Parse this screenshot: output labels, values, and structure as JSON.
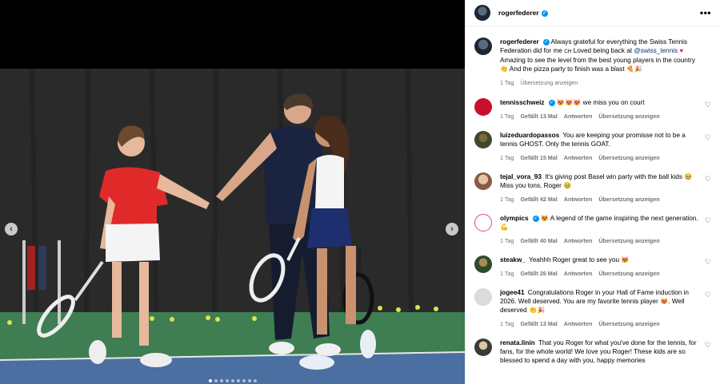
{
  "post": {
    "author": "rogerfederer",
    "more_label": "•••"
  },
  "caption": {
    "username": "rogerfederer",
    "text_1": "Always grateful for everything the Swiss Tennis Federation did for me ",
    "flag": "CH",
    "text_2": " Loved being back at ",
    "mention": "@swiss_tennis",
    "text_3": " Amazing to see the level from the best young players in the country ",
    "text_4": " And the pizza party to finish was a blast ",
    "time": "1 Tag",
    "translate": "Übersetzung anzeigen"
  },
  "comments": [
    {
      "username": "tennisschweiz",
      "verified": true,
      "text": "😻😻😻 we miss you on court",
      "time": "1 Tag",
      "likes": "Gefällt 13 Mal",
      "reply": "Antworten",
      "translate": "Übersetzung anzeigen"
    },
    {
      "username": "luizeduardopassos",
      "verified": false,
      "text": "You are keeping your promisse not to be a tennis GHOST. Only the tennis GOAT.",
      "time": "1 Tag",
      "likes": "Gefällt 15 Mal",
      "reply": "Antworten",
      "translate": "Übersetzung anzeigen"
    },
    {
      "username": "tejal_vora_93",
      "verified": false,
      "text": "It's giving post Basel win party with the ball kids 🥹 Miss you tons, Roger 🥹",
      "time": "1 Tag",
      "likes": "Gefällt 42 Mal",
      "reply": "Antworten",
      "translate": "Übersetzung anzeigen"
    },
    {
      "username": "olympics",
      "verified": true,
      "text": "😻 A legend of the game inspiring the next generation. 💪",
      "time": "1 Tag",
      "likes": "Gefällt 40 Mal",
      "reply": "Antworten",
      "translate": "Übersetzung anzeigen"
    },
    {
      "username": "steakw_",
      "verified": false,
      "text": "Yeahhh Roger great to see you 😻",
      "time": "1 Tag",
      "likes": "Gefällt 26 Mal",
      "reply": "Antworten",
      "translate": "Übersetzung anzeigen"
    },
    {
      "username": "jogee41",
      "verified": false,
      "text": "Congratulations Roger in your Hall of Fame induction in 2026. Well deserved. You are my favorite tennis player 😻. Well deserved 👏🎉",
      "time": "1 Tag",
      "likes": "Gefällt 13 Mal",
      "reply": "Antworten",
      "translate": "Übersetzung anzeigen"
    },
    {
      "username": "renata.linin",
      "verified": false,
      "text": "That you Roger for what you've done for the tennis, for fans, for the whole world! We love you Roger! These kids are so blessed to spend a day with you, happy memories",
      "time": "",
      "likes": "",
      "reply": "",
      "translate": ""
    }
  ],
  "icons": {
    "prev": "chevron-left-icon",
    "next": "chevron-right-icon",
    "heart": "heart-icon",
    "verified": "verified-badge-icon"
  },
  "colors": {
    "link": "#00376b",
    "verified": "#0095f6",
    "meta": "#737373"
  },
  "carousel": {
    "slide_count": 9,
    "active_index": 0
  }
}
